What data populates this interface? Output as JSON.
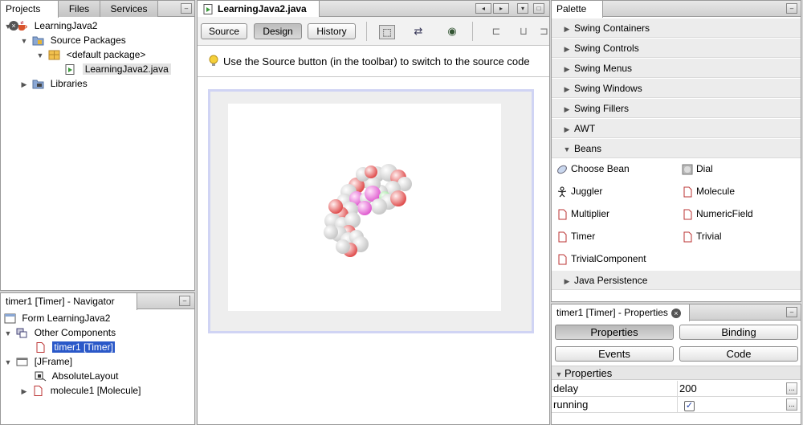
{
  "projects_panel": {
    "tabs": [
      "Projects",
      "Files",
      "Services"
    ],
    "tree": {
      "project": "LearningJava2",
      "source_packages": "Source Packages",
      "default_package": "<default package>",
      "file": "LearningJava2.java",
      "libraries": "Libraries"
    }
  },
  "navigator_panel": {
    "title": "timer1 [Timer] - Navigator",
    "tree": {
      "form": "Form LearningJava2",
      "other_components": "Other Components",
      "timer": "timer1 [Timer]",
      "jframe": "[JFrame]",
      "layout": "AbsoluteLayout",
      "molecule": "molecule1 [Molecule]"
    }
  },
  "editor": {
    "tab_title": "LearningJava2.java",
    "buttons": {
      "source": "Source",
      "design": "Design",
      "history": "History"
    },
    "hint": "Use the Source button (in the toolbar) to switch to the source code"
  },
  "palette": {
    "title": "Palette",
    "categories_top": [
      "Swing Containers",
      "Swing Controls",
      "Swing Menus",
      "Swing Windows",
      "Swing Fillers",
      "AWT",
      "Beans"
    ],
    "beans": [
      "Choose Bean",
      "Dial",
      "Juggler",
      "Molecule",
      "Multiplier",
      "NumericField",
      "Timer",
      "Trivial",
      "TrivialComponent"
    ],
    "category_bottom": "Java Persistence"
  },
  "properties_panel": {
    "title": "timer1 [Timer] - Properties",
    "buttons": {
      "properties": "Properties",
      "binding": "Binding",
      "events": "Events",
      "code": "Code"
    },
    "section": "Properties",
    "rows": [
      {
        "name": "delay",
        "value": "200"
      },
      {
        "name": "running",
        "value": ""
      }
    ],
    "ellipsis": "..."
  },
  "colors": {
    "selection": "#2a58c8",
    "design_frame": "#d0d4f4"
  },
  "icons": {
    "tab_close": "×",
    "tree_expanded": "▼",
    "tree_collapsed": "▶",
    "minimize": "–",
    "hint_icon": "lightbulb-icon",
    "checkbox_checked": "✓"
  }
}
